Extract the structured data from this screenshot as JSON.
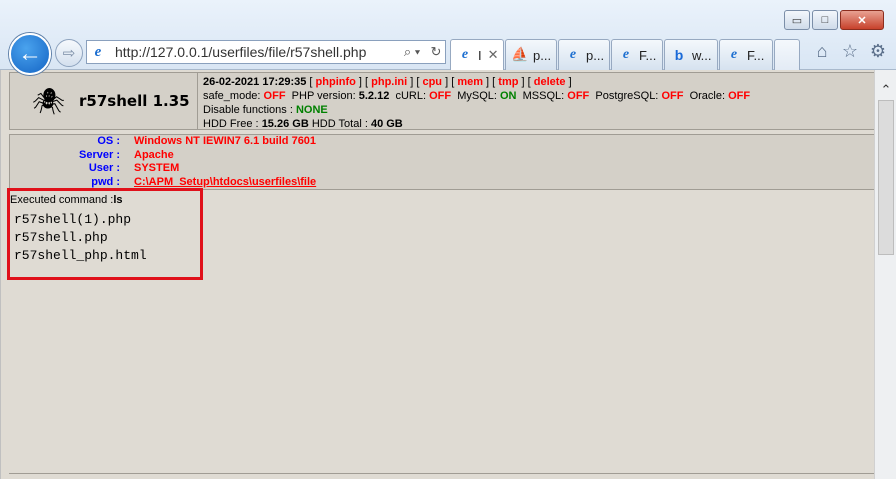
{
  "browser": {
    "window_controls": {
      "minimize": "▭",
      "maximize": "□",
      "close": "✕"
    },
    "back_icon": "arrow-left-icon",
    "forward_icon": "arrow-right-icon",
    "address": {
      "url": "http://127.0.0.1/userfiles/file/r57shell.php",
      "search_glyph": "⌕ ▾",
      "refresh_glyph": "↻"
    },
    "tabs": [
      {
        "icon": "e",
        "label": "I",
        "close": "✕",
        "active": true
      },
      {
        "icon": "⛵",
        "label": "p...",
        "active": false
      },
      {
        "icon": "e",
        "label": "p...",
        "active": false
      },
      {
        "icon": "e",
        "label": "F...",
        "active": false
      },
      {
        "icon": "b",
        "label": "w...",
        "active": false
      },
      {
        "icon": "e",
        "label": "F...",
        "active": false
      }
    ],
    "toolbar_icons": {
      "home": "⌂",
      "favorites": "☆",
      "settings": "⚙"
    }
  },
  "header": {
    "logo_text": "r57shell 1.35",
    "datetime": "26-02-2021 17:29:35",
    "links": [
      "phpinfo",
      "php.ini",
      "cpu",
      "mem",
      "tmp",
      "delete"
    ],
    "safe_mode_label": "safe_mode:",
    "safe_mode": "OFF",
    "php_version_label": "PHP version:",
    "php_version": "5.2.12",
    "curl_label": "cURL:",
    "curl": "OFF",
    "mysql_label": "MySQL:",
    "mysql": "ON",
    "mssql_label": "MSSQL:",
    "mssql": "OFF",
    "postgresql_label": "PostgreSQL:",
    "postgresql": "OFF",
    "oracle_label": "Oracle:",
    "oracle": "OFF",
    "disable_functions_label": "Disable functions :",
    "disable_functions": "NONE",
    "hdd_free_label": "HDD Free :",
    "hdd_free": "15.26 GB",
    "hdd_total_label": "HDD Total :",
    "hdd_total": "40 GB"
  },
  "system": {
    "os_label": "OS :",
    "os": "Windows NT IEWIN7 6.1 build 7601",
    "server_label": "Server :",
    "server": "Apache",
    "user_label": "User :",
    "user": "SYSTEM",
    "pwd_label": "pwd :",
    "pwd": "C:\\APM_Setup\\htdocs\\userfiles\\file"
  },
  "command": {
    "label": "Executed command :",
    "value": "ls",
    "output": [
      "r57shell(1).php",
      "r57shell.php",
      "r57shell_php.html"
    ]
  },
  "colors": {
    "highlight": "#e0101a",
    "link": "#ff0000",
    "on": "#008000"
  }
}
